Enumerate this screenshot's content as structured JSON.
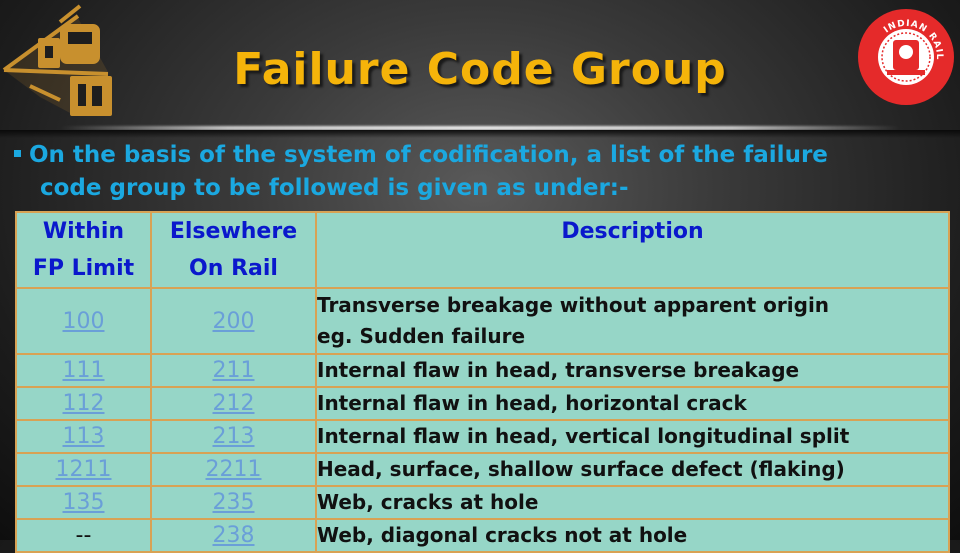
{
  "slide": {
    "title": "Failure Code Group",
    "intro_line1": "On the basis of the system of codification, a list of the failure",
    "intro_line2": "code group to be followed is given as under:-",
    "logos": {
      "left": "iricen-train-logo",
      "right_text": "INDIAN RAILWAYS"
    },
    "colors": {
      "title": "#f5b40a",
      "intro": "#1ba8e0",
      "table_bg": "#96d6c7",
      "table_border": "#d8a254",
      "header_text": "#0a18cc",
      "link_text": "#6a9fd8",
      "logo_red": "#e52a2a",
      "logo_gold": "#c8902e"
    }
  },
  "table": {
    "headers": {
      "col1_line1": "Within",
      "col1_line2": "FP Limit",
      "col2_line1": "Elsewhere",
      "col2_line2": "On Rail",
      "col3": "Description"
    },
    "rows": [
      {
        "within": "100",
        "elsewhere": "200",
        "desc_line1": "Transverse breakage without apparent origin",
        "desc_line2": "eg. Sudden failure"
      },
      {
        "within": "111",
        "elsewhere": "211",
        "desc": "Internal flaw in head, transverse breakage"
      },
      {
        "within": "112",
        "elsewhere": "212",
        "desc": "Internal flaw in head, horizontal crack"
      },
      {
        "within": "113",
        "elsewhere": "213",
        "desc": "Internal flaw in head, vertical longitudinal split"
      },
      {
        "within": "1211",
        "elsewhere": "2211",
        "desc": "Head, surface, shallow surface defect (flaking)"
      },
      {
        "within": "135",
        "elsewhere": "235",
        "desc": "Web, cracks at hole"
      },
      {
        "within": "--",
        "elsewhere": "238",
        "desc": "Web, diagonal cracks not at hole"
      }
    ]
  }
}
